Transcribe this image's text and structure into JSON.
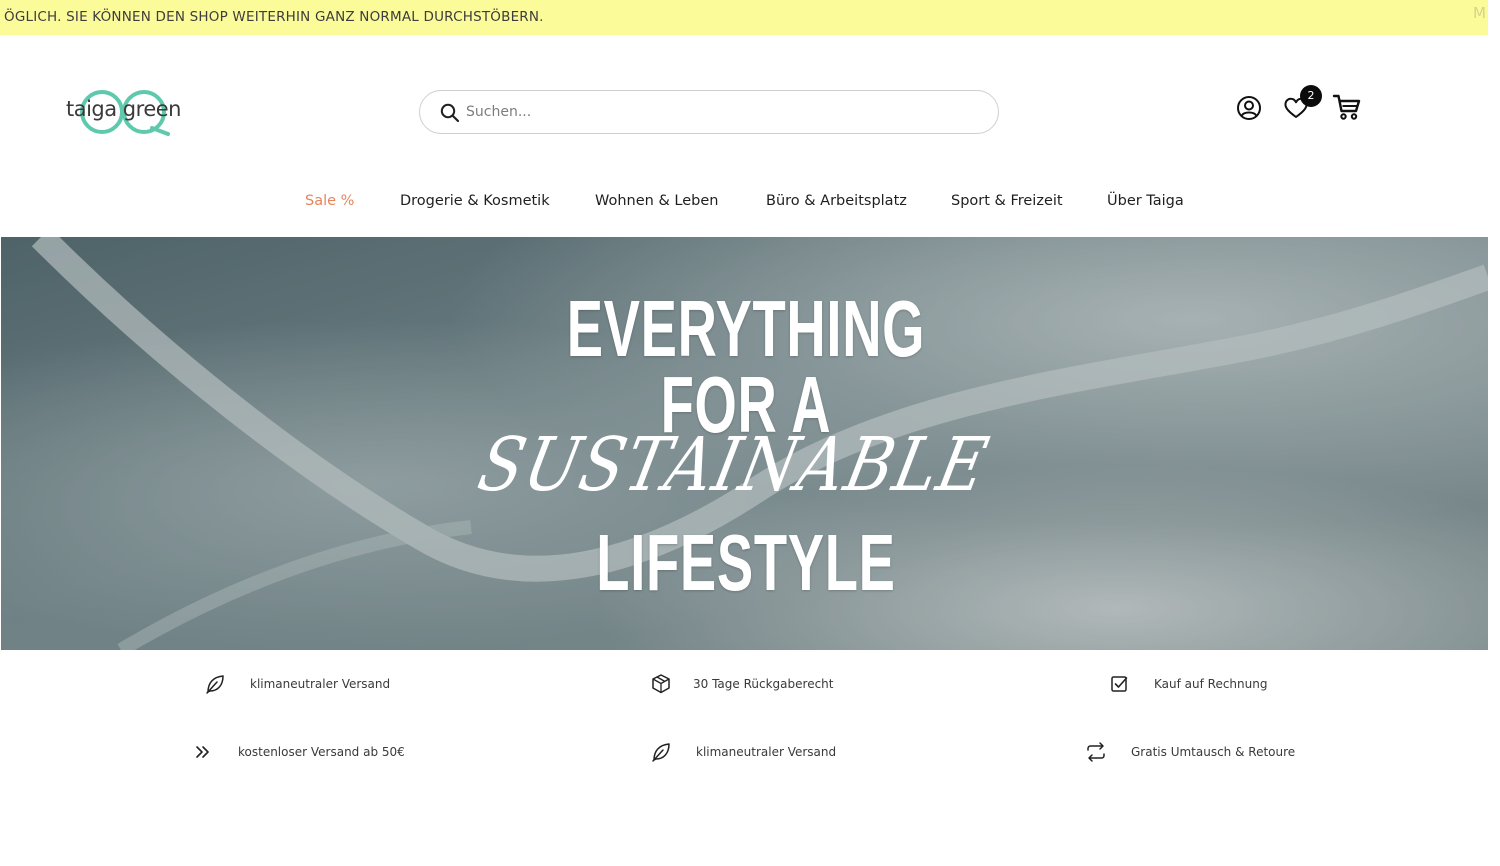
{
  "notice": {
    "text": "ÖGLICH. SIE KÖNNEN DEN SHOP WEITERHIN GANZ NORMAL DURCHSTÖBERN.",
    "close": "M"
  },
  "header": {
    "logo_text": "taiga green",
    "search_placeholder": "Suchen...",
    "wishlist_count": "2",
    "icons": [
      "search-icon",
      "account-icon",
      "heart-icon",
      "cart-icon"
    ]
  },
  "nav": {
    "items": [
      {
        "label": "Sale %"
      },
      {
        "label": "Drogerie & Kosmetik"
      },
      {
        "label": "Wohnen & Leben"
      },
      {
        "label": "Büro & Arbeitsplatz"
      },
      {
        "label": "Sport & Freizeit"
      },
      {
        "label": "Über Taiga"
      }
    ]
  },
  "hero": {
    "line1": "EVERYTHING",
    "line2": "FOR A",
    "line3": "SUSTAINABLE",
    "line4": "LIFESTYLE"
  },
  "features": {
    "row1": [
      {
        "icon": "leaf-icon",
        "label": "klimaneutraler Versand"
      },
      {
        "icon": "box-icon",
        "label": "30 Tage Rückgaberecht"
      },
      {
        "icon": "checkbox-icon",
        "label": "Kauf auf Rechnung"
      }
    ],
    "row2": [
      {
        "icon": "double-chevron-icon",
        "label": "kostenloser Versand ab 50€"
      },
      {
        "icon": "leaf-icon",
        "label": "klimaneutraler Versand"
      },
      {
        "icon": "exchange-icon",
        "label": "Gratis Umtausch & Retoure"
      }
    ]
  },
  "colors": {
    "notice_bg": "#fbfb9a",
    "logo_accent": "#5fc9ad",
    "sale": "#e6855c",
    "text": "#1f1f1f"
  }
}
